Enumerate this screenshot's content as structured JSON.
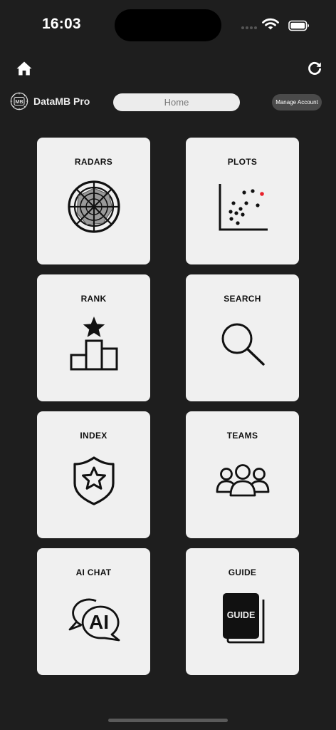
{
  "status_bar": {
    "time": "16:03"
  },
  "header": {
    "brand_name": "DataMB Pro",
    "logo_text": "MB",
    "page_title": "Home",
    "manage_account_label": "Manage Account"
  },
  "tiles": [
    {
      "label": "RADARS",
      "icon": "radar-chart-icon"
    },
    {
      "label": "PLOTS",
      "icon": "scatter-plot-icon"
    },
    {
      "label": "RANK",
      "icon": "podium-star-icon"
    },
    {
      "label": "SEARCH",
      "icon": "magnifier-icon"
    },
    {
      "label": "INDEX",
      "icon": "shield-star-icon"
    },
    {
      "label": "TEAMS",
      "icon": "people-group-icon"
    },
    {
      "label": "AI CHAT",
      "icon": "ai-chat-bubble-icon",
      "icon_text": "AI"
    },
    {
      "label": "GUIDE",
      "icon": "guide-book-icon",
      "icon_text": "GUIDE"
    }
  ],
  "colors": {
    "background": "#1e1e1e",
    "tile": "#f0f0f0",
    "accent_point": "#e8202a"
  }
}
